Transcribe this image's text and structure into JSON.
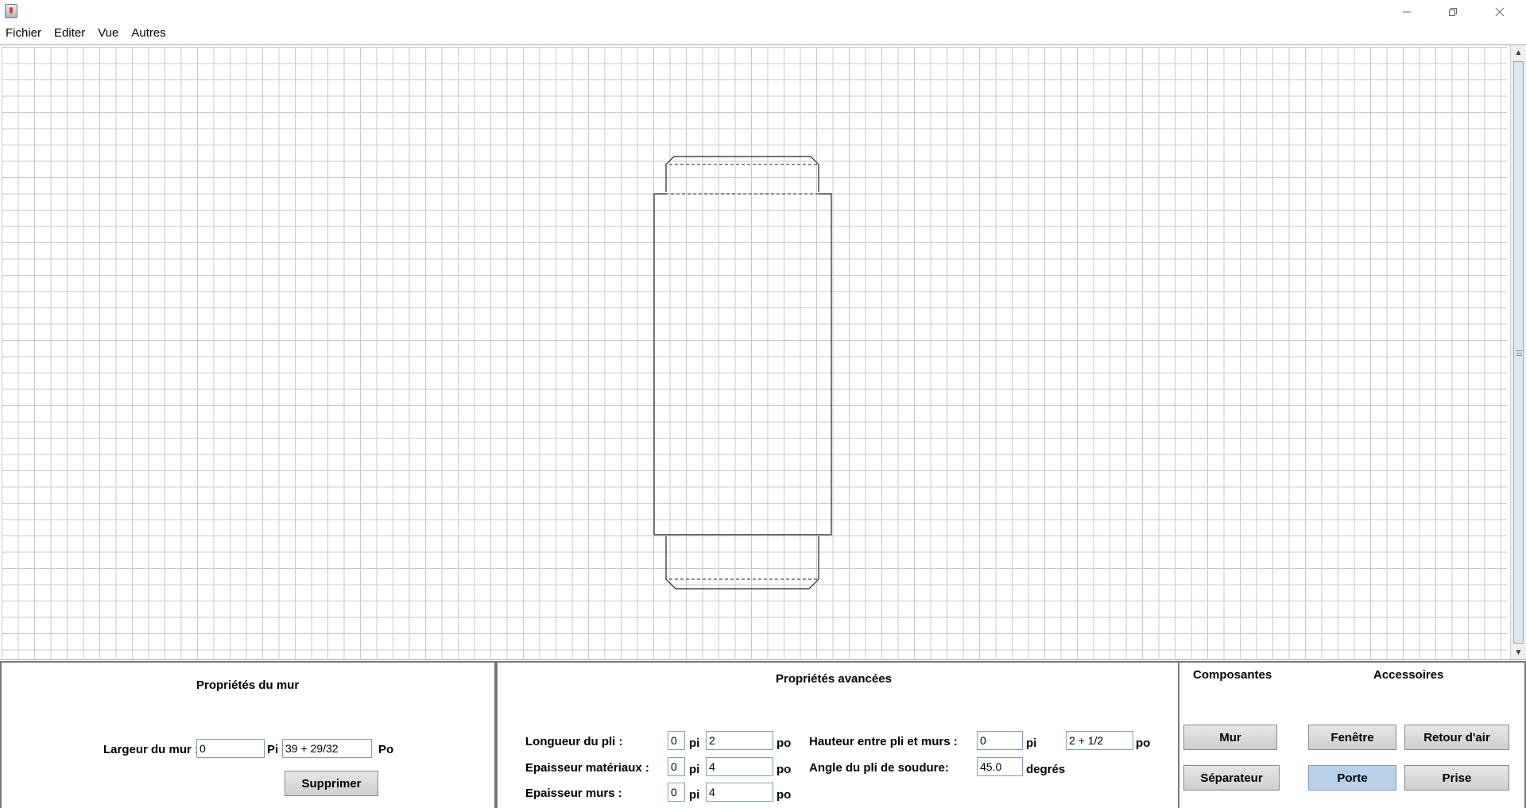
{
  "window": {
    "title": ""
  },
  "menu": [
    "Fichier",
    "Editer",
    "Vue",
    "Autres"
  ],
  "window_controls": {
    "minimize_icon": "minimize-icon",
    "restore_icon": "restore-icon",
    "close_icon": "close-icon"
  },
  "wall_panel": {
    "title": "Propriétés du mur",
    "width_label": "Largeur du mur :",
    "width_pi_value": "0",
    "pi_unit": "Pi",
    "width_po_value": "39 + 29/32",
    "po_unit": "Po",
    "delete_label": "Supprimer"
  },
  "advanced_panel": {
    "title": "Propriétés avancées",
    "fold_length_label": "Longueur du pli :",
    "fold_length_pi": "0",
    "fold_length_po": "2",
    "material_thickness_label": "Epaisseur matériaux :",
    "material_thickness_pi": "0",
    "material_thickness_po": "4",
    "wall_thickness_label": "Epaisseur murs :",
    "wall_thickness_pi": "0",
    "wall_thickness_po": "4",
    "height_label": "Hauteur entre pli et murs :",
    "height_pi": "0",
    "height_po": "2 + 1/2",
    "weld_angle_label": "Angle du pli de soudure:",
    "weld_angle_value": "45.0",
    "degrees_unit": "degrés",
    "pi_unit": "pi",
    "po_unit": "po"
  },
  "components_panel": {
    "components_title": "Composantes",
    "accessories_title": "Accessoires",
    "buttons": {
      "mur": "Mur",
      "separateur": "Séparateur",
      "fenetre": "Fenêtre",
      "porte": "Porte",
      "retour_air": "Retour d'air",
      "prise": "Prise"
    },
    "selected": "Porte"
  },
  "colors": {
    "grid": "#c9c9c9",
    "selected_button": "#b8d1e9",
    "panel_border": "#777777"
  }
}
